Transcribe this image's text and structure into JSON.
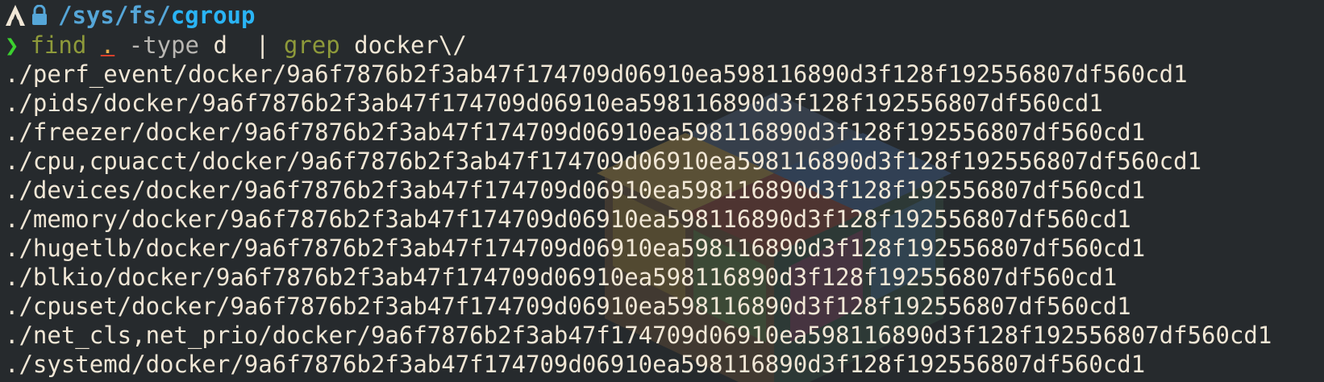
{
  "prompt": {
    "path_prefix": "/",
    "path_seg1": "sys",
    "path_sep1": "/",
    "path_seg2": "fs",
    "path_sep2": "/",
    "path_current": "cgroup"
  },
  "command": {
    "chevron": "❯",
    "find": "find",
    "dot": ".",
    "type_flag": "-type",
    "type_arg": "d",
    "pipe": "|",
    "grep": "grep",
    "grep_arg": "docker\\/"
  },
  "output_lines": [
    "./perf_event/docker/9a6f7876b2f3ab47f174709d06910ea598116890d3f128f192556807df560cd1",
    "./pids/docker/9a6f7876b2f3ab47f174709d06910ea598116890d3f128f192556807df560cd1",
    "./freezer/docker/9a6f7876b2f3ab47f174709d06910ea598116890d3f128f192556807df560cd1",
    "./cpu,cpuacct/docker/9a6f7876b2f3ab47f174709d06910ea598116890d3f128f192556807df560cd1",
    "./devices/docker/9a6f7876b2f3ab47f174709d06910ea598116890d3f128f192556807df560cd1",
    "./memory/docker/9a6f7876b2f3ab47f174709d06910ea598116890d3f128f192556807df560cd1",
    "./hugetlb/docker/9a6f7876b2f3ab47f174709d06910ea598116890d3f128f192556807df560cd1",
    "./blkio/docker/9a6f7876b2f3ab47f174709d06910ea598116890d3f128f192556807df560cd1",
    "./cpuset/docker/9a6f7876b2f3ab47f174709d06910ea598116890d3f128f192556807df560cd1",
    "./net_cls,net_prio/docker/9a6f7876b2f3ab47f174709d06910ea598116890d3f128f192556807df560cd1",
    "./systemd/docker/9a6f7876b2f3ab47f174709d06910ea598116890d3f128f192556807df560cd1"
  ],
  "colors": {
    "background": "#262a2d",
    "text": "#f1e7d6",
    "path": "#2ab4f5",
    "chevron": "#3cd12f",
    "command": "#8e9a3a"
  }
}
